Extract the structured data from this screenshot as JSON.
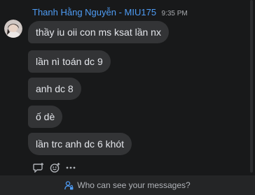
{
  "message_group": {
    "sender_name": "Thanh Hằng Nguyễn - MIU175",
    "time": "9:35 PM",
    "messages": [
      "thầy iu oii con ms ksat lần nx",
      "lần nì toán dc 9",
      "anh dc 8",
      "ố dè",
      "lần trc anh dc 6 khót"
    ]
  },
  "actions": {
    "reply_icon": "reply-icon",
    "react_icon": "smiley-icon",
    "more_icon": "more-icon"
  },
  "footer": {
    "icon": "person-lock-icon",
    "text": "Who can see your messages?"
  },
  "colors": {
    "background": "#18191a",
    "bubble": "#333436",
    "sender_name": "#4e9cf5",
    "footer_background": "#242526"
  }
}
